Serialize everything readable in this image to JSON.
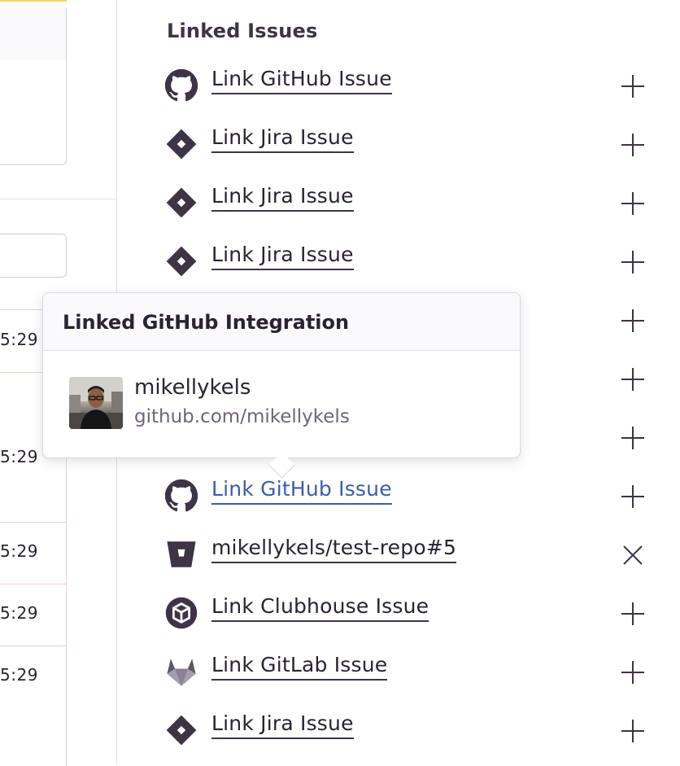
{
  "panel": {
    "title": "Linked Issues",
    "items": [
      {
        "provider": "github",
        "icon": "github-icon",
        "label": "Link GitHub Issue",
        "action": "add"
      },
      {
        "provider": "jira",
        "icon": "jira-icon",
        "label": "Link Jira Issue",
        "action": "add"
      },
      {
        "provider": "jira",
        "icon": "jira-icon",
        "label": "Link Jira Issue",
        "action": "add"
      },
      {
        "provider": "jira",
        "icon": "jira-icon",
        "label": "Link Jira Issue",
        "action": "add"
      },
      {
        "provider": "hidden",
        "icon": "",
        "label": "",
        "action": "add"
      },
      {
        "provider": "hidden",
        "icon": "",
        "label": "",
        "action": "add"
      },
      {
        "provider": "hidden",
        "icon": "",
        "label": "",
        "action": "add"
      },
      {
        "provider": "github",
        "icon": "github-icon",
        "label": "Link GitHub Issue",
        "action": "add",
        "active": true
      },
      {
        "provider": "bitbucket",
        "icon": "bitbucket-icon",
        "label": "mikellykels/test-repo#5",
        "action": "remove"
      },
      {
        "provider": "clubhouse",
        "icon": "clubhouse-icon",
        "label": "Link Clubhouse Issue",
        "action": "add"
      },
      {
        "provider": "gitlab",
        "icon": "gitlab-icon",
        "label": "Link GitLab Issue",
        "action": "add"
      },
      {
        "provider": "jira",
        "icon": "jira-icon",
        "label": "Link Jira Issue",
        "action": "add"
      }
    ]
  },
  "tooltip": {
    "title": "Linked GitHub Integration",
    "account_name": "mikellykels",
    "account_url": "github.com/mikellykels"
  },
  "left_times": [
    "5:29",
    "5:29",
    "5:29",
    "5:29",
    "5:29"
  ],
  "colors": {
    "text": "#2b2233",
    "icon": "#3e3446",
    "active_link": "#3a5ea8",
    "divider": "#e2dee6",
    "row_border": "#e9d2cf"
  }
}
